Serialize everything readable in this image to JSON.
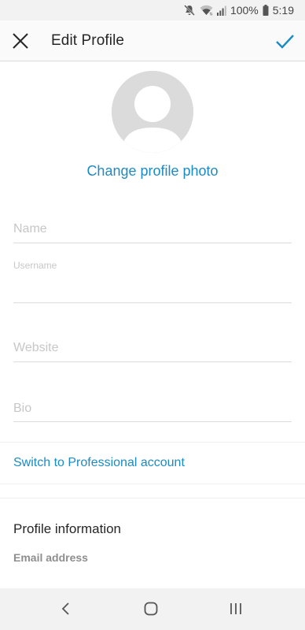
{
  "status_bar": {
    "battery": "100%",
    "time": "5:19",
    "icons": [
      "mute-icon",
      "wifi-icon",
      "signal-icon",
      "battery-icon"
    ]
  },
  "header": {
    "title": "Edit Profile",
    "close_icon": "close-icon",
    "done_icon": "check-icon"
  },
  "profile": {
    "change_photo_label": "Change profile photo"
  },
  "form": {
    "name_placeholder": "Name",
    "username_label": "Username",
    "username_value": "",
    "website_placeholder": "Website",
    "bio_placeholder": "Bio"
  },
  "professional_link": "Switch to Professional account",
  "profile_info": {
    "title": "Profile information",
    "email_label": "Email address"
  },
  "nav": {
    "icons": [
      "back-icon",
      "home-icon",
      "recent-apps-icon"
    ]
  },
  "colors": {
    "accent": "#1b8bc4",
    "placeholder": "#c7c7c7",
    "divider": "#dbdbdb"
  }
}
